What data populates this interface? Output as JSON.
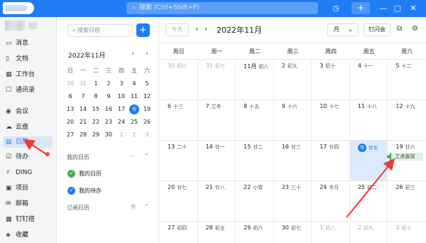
{
  "titlebar": {
    "search_placeholder": "搜索 (Ctrl+Shift+F)",
    "history_icon": "history-icon",
    "plus": "+",
    "minimize": "—",
    "restore": "▢",
    "close": "✕"
  },
  "sidebar": {
    "items": [
      {
        "label": "消息",
        "icon": "message-icon"
      },
      {
        "label": "文档",
        "icon": "document-icon"
      },
      {
        "label": "工作台",
        "icon": "workbench-icon"
      },
      {
        "label": "通讯录",
        "icon": "contacts-icon"
      },
      {
        "label": "会议",
        "icon": "meeting-icon"
      },
      {
        "label": "云盘",
        "icon": "cloud-icon"
      },
      {
        "label": "日历",
        "icon": "calendar-icon"
      },
      {
        "label": "待办",
        "icon": "todo-icon"
      },
      {
        "label": "DING",
        "icon": "ding-icon"
      },
      {
        "label": "项目",
        "icon": "project-icon"
      },
      {
        "label": "邮箱",
        "icon": "mail-icon"
      },
      {
        "label": "钉钉搭",
        "icon": "builder-icon"
      },
      {
        "label": "收藏",
        "icon": "favorite-icon"
      }
    ]
  },
  "mini": {
    "search_placeholder": "搜索日程",
    "title": "2022年11月",
    "weekdays": [
      "日",
      "一",
      "二",
      "三",
      "四",
      "五",
      "六"
    ],
    "weeks": [
      [
        "30",
        "31",
        "1",
        "2",
        "3",
        "4",
        "5"
      ],
      [
        "6",
        "7",
        "8",
        "9",
        "10",
        "11",
        "12"
      ],
      [
        "13",
        "14",
        "15",
        "16",
        "17",
        "18",
        "19"
      ],
      [
        "20",
        "21",
        "22",
        "23",
        "24",
        "25",
        "26"
      ],
      [
        "27",
        "28",
        "29",
        "30",
        "1",
        "2",
        "3"
      ]
    ],
    "my_calendars_title": "我的日历",
    "my_calendars": [
      "我的日历",
      "我的待办"
    ],
    "subscribed_title": "订阅日历",
    "more": "···"
  },
  "main": {
    "today": "今天",
    "month_title": "2022年11月",
    "view": "月",
    "flash": "钉闪会",
    "weekdays": [
      "周日",
      "周一",
      "周二",
      "周三",
      "周四",
      "周五",
      "周六"
    ],
    "weeks": [
      [
        {
          "n": "30",
          "l": "初六"
        },
        {
          "n": "31",
          "l": "初七"
        },
        {
          "n": "11月",
          "l": "初八"
        },
        {
          "n": "2",
          "l": "初九"
        },
        {
          "n": "3",
          "l": "初十"
        },
        {
          "n": "4",
          "l": "十一"
        },
        {
          "n": "5",
          "l": "十二"
        }
      ],
      [
        {
          "n": "6",
          "l": "十三"
        },
        {
          "n": "7",
          "l": "立冬"
        },
        {
          "n": "8",
          "l": "十五"
        },
        {
          "n": "9",
          "l": "十六"
        },
        {
          "n": "10",
          "l": "十七"
        },
        {
          "n": "11",
          "l": "十八"
        },
        {
          "n": "12",
          "l": "十九"
        }
      ],
      [
        {
          "n": "13",
          "l": "二十"
        },
        {
          "n": "14",
          "l": "廿一"
        },
        {
          "n": "15",
          "l": "廿二"
        },
        {
          "n": "16",
          "l": "廿三"
        },
        {
          "n": "17",
          "l": "廿四"
        },
        {
          "n": "今",
          "l": "廿五"
        },
        {
          "n": "19",
          "l": "廿六"
        }
      ],
      [
        {
          "n": "20",
          "l": "廿七"
        },
        {
          "n": "21",
          "l": "廿八"
        },
        {
          "n": "22",
          "l": "小雪"
        },
        {
          "n": "23",
          "l": "三十"
        },
        {
          "n": "24",
          "l": "冬月"
        },
        {
          "n": "25",
          "l": "初二"
        },
        {
          "n": "26",
          "l": "初三"
        }
      ],
      [
        {
          "n": "27",
          "l": "初四"
        },
        {
          "n": "28",
          "l": "初五"
        },
        {
          "n": "29",
          "l": "初六"
        },
        {
          "n": "30",
          "l": "初七"
        },
        {
          "n": "1",
          "l": "初八"
        },
        {
          "n": "2",
          "l": "初九"
        },
        {
          "n": "3",
          "l": "初十"
        }
      ]
    ],
    "event": "三点会议"
  },
  "colors": {
    "accent": "#1f7cf5",
    "annotation": "#f2392c",
    "event_green": "#3bb44a"
  }
}
